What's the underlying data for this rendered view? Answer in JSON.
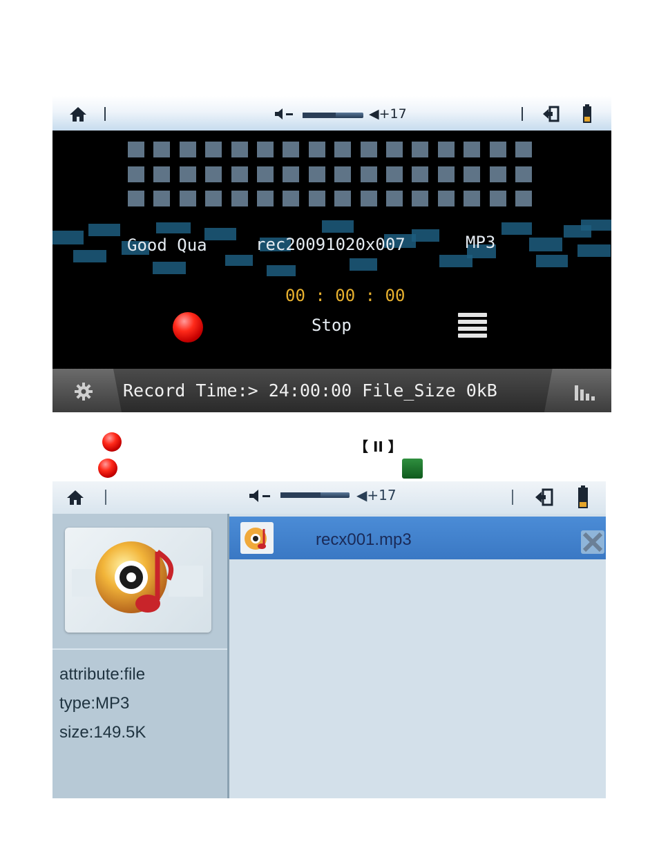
{
  "recorder": {
    "topbar": {
      "home_icon": "home-icon",
      "volume_down_icon": "volume-down-icon",
      "volume_up_label": "◀+17",
      "volume_level": 17,
      "exit_icon": "exit-icon",
      "battery_icon": "battery-icon"
    },
    "quality": "Good Qua",
    "filename": "rec20091020x007",
    "format": "MP3",
    "timer": "00 : 00 : 00",
    "status": "Stop",
    "bottombar": {
      "settings_icon": "gear-icon",
      "info": "Record Time:> 24:00:00 File_Size 0kB",
      "stats_icon": "bar-chart-icon"
    }
  },
  "caption": {
    "pause_symbol": "【 II 】"
  },
  "browser": {
    "topbar": {
      "volume_label": "◀+17",
      "volume_level": 17
    },
    "file_attributes": {
      "attribute": "attribute:file",
      "type": "type:MP3",
      "size": "size:149.5K"
    },
    "files": [
      {
        "name": "recx001.mp3",
        "selected": true
      }
    ]
  }
}
